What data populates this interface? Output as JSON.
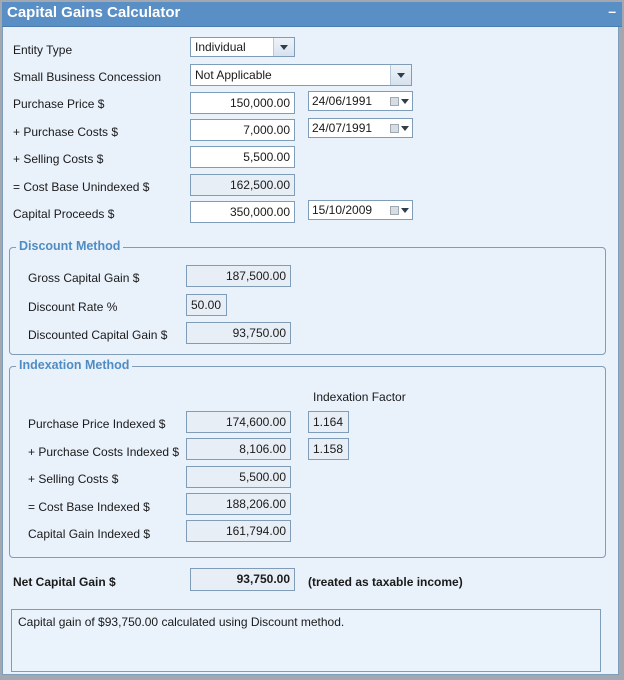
{
  "window": {
    "title": "Capital Gains Calculator",
    "minimize_glyph": "–"
  },
  "inputs": {
    "entity_type": {
      "label": "Entity Type",
      "value": "Individual"
    },
    "small_business_concession": {
      "label": "Small Business Concession",
      "value": "Not Applicable"
    },
    "purchase_price": {
      "label": "Purchase Price $",
      "value": "150,000.00",
      "date": "24/06/1991"
    },
    "purchase_costs": {
      "label": "+ Purchase Costs $",
      "value": "7,000.00",
      "date": "24/07/1991"
    },
    "selling_costs": {
      "label": "+ Selling Costs $",
      "value": "5,500.00"
    },
    "cost_base_unindexed": {
      "label": "= Cost Base Unindexed $",
      "value": "162,500.00"
    },
    "capital_proceeds": {
      "label": "Capital Proceeds $",
      "value": "350,000.00",
      "date": "15/10/2009"
    }
  },
  "discount_method": {
    "title": "Discount Method",
    "gross_capital_gain": {
      "label": "Gross Capital Gain $",
      "value": "187,500.00"
    },
    "discount_rate": {
      "label": "Discount Rate %",
      "value": "50.00"
    },
    "discounted_capital_gain": {
      "label": "Discounted Capital Gain $",
      "value": "93,750.00"
    }
  },
  "indexation_method": {
    "title": "Indexation Method",
    "factor_header": "Indexation Factor",
    "purchase_price_indexed": {
      "label": "Purchase Price Indexed $",
      "value": "174,600.00",
      "factor": "1.164"
    },
    "purchase_costs_indexed": {
      "label": "+ Purchase Costs Indexed $",
      "value": "8,106.00",
      "factor": "1.158"
    },
    "selling_costs": {
      "label": "+ Selling Costs $",
      "value": "5,500.00"
    },
    "cost_base_indexed": {
      "label": "= Cost Base Indexed $",
      "value": "188,206.00"
    },
    "capital_gain_indexed": {
      "label": "Capital Gain Indexed $",
      "value": "161,794.00"
    }
  },
  "result": {
    "net_capital_gain_label": "Net Capital Gain $",
    "net_capital_gain_value": "93,750.00",
    "note": "(treated as taxable income)",
    "summary": "Capital gain of $93,750.00 calculated using Discount method."
  }
}
